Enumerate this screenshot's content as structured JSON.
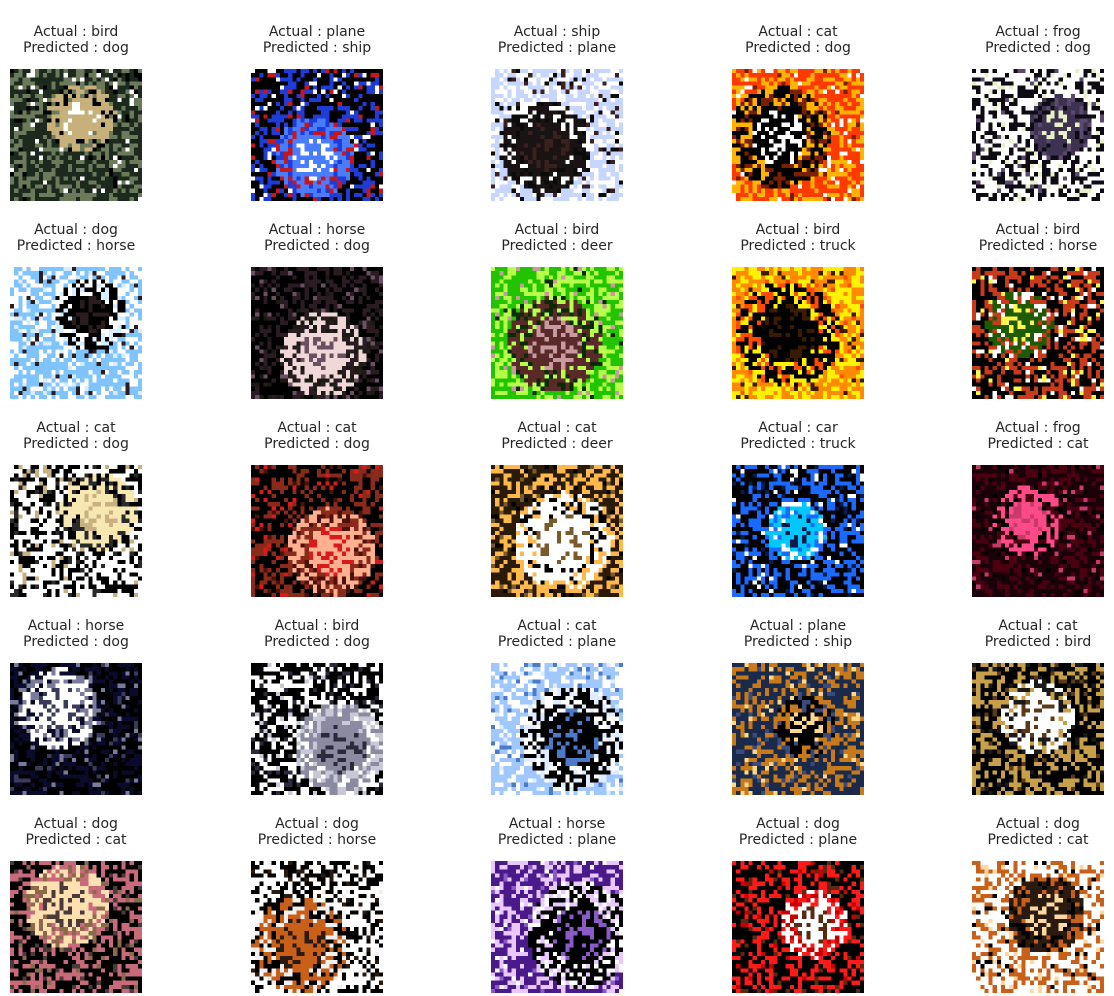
{
  "grid": {
    "rows": 5,
    "cols": 5,
    "panels": [
      {
        "actual": "Actual : bird",
        "predicted": "Predicted : dog",
        "image": "bird-perched-branch",
        "colors": [
          "#1b2a1d",
          "#6a7a5a",
          "#c8b07a",
          "#ffffff",
          "#000000"
        ]
      },
      {
        "actual": "Actual : plane",
        "predicted": "Predicted : ship",
        "image": "plane-in-blue-circle",
        "colors": [
          "#000000",
          "#1e3cd8",
          "#4a7cff",
          "#ffffff",
          "#c9161b"
        ]
      },
      {
        "actual": "Actual : ship",
        "predicted": "Predicted : plane",
        "image": "ship-dark-hull",
        "colors": [
          "#c7d6ff",
          "#ffffff",
          "#1a1313",
          "#3b2020",
          "#0b0b0b"
        ]
      },
      {
        "actual": "Actual : cat",
        "predicted": "Predicted : dog",
        "image": "cat-on-orange",
        "colors": [
          "#ff3a00",
          "#ffb400",
          "#000000",
          "#ffffff",
          "#7a1f00"
        ]
      },
      {
        "actual": "Actual : frog",
        "predicted": "Predicted : dog",
        "image": "frog-dark-blob",
        "colors": [
          "#ffffff",
          "#0e0b14",
          "#3d3350",
          "#e8f0c8",
          "#5a4a6e"
        ]
      },
      {
        "actual": "Actual : dog",
        "predicted": "Predicted : horse",
        "image": "dog-on-beach",
        "colors": [
          "#7fc3ff",
          "#ffffff",
          "#000000",
          "#2b1d1d",
          "#d8ecff"
        ]
      },
      {
        "actual": "Actual : horse",
        "predicted": "Predicted : dog",
        "image": "horse-dark-scene",
        "colors": [
          "#000000",
          "#2a1c22",
          "#f0d8d8",
          "#6a5060",
          "#1a1a12"
        ]
      },
      {
        "actual": "Actual : bird",
        "predicted": "Predicted : deer",
        "image": "bird-green-grass",
        "colors": [
          "#22c400",
          "#b6ff4a",
          "#5a2a2a",
          "#c89aa0",
          "#0a2a00"
        ]
      },
      {
        "actual": "Actual : bird",
        "predicted": "Predicted : truck",
        "image": "bird-yellow-stripes",
        "colors": [
          "#ff8a00",
          "#fff200",
          "#000000",
          "#3a1a00",
          "#ff4a00"
        ]
      },
      {
        "actual": "Actual : bird",
        "predicted": "Predicted : horse",
        "image": "bird-red-on-branch",
        "colors": [
          "#000000",
          "#c83a1a",
          "#1e5a00",
          "#fff84a",
          "#ffffff"
        ]
      },
      {
        "actual": "Actual : cat",
        "predicted": "Predicted : dog",
        "image": "cat-black-on-white",
        "colors": [
          "#ffffff",
          "#000000",
          "#f6e8b0",
          "#c8b080",
          "#2a2a2a"
        ]
      },
      {
        "actual": "Actual : cat",
        "predicted": "Predicted : dog",
        "image": "cat-dark-red",
        "colors": [
          "#000000",
          "#8a2a1a",
          "#ffb090",
          "#d81a1a",
          "#4a1208"
        ]
      },
      {
        "actual": "Actual : cat",
        "predicted": "Predicted : deer",
        "image": "cat-tabby-face",
        "colors": [
          "#2a1a08",
          "#ffb84a",
          "#ffffff",
          "#7a5a2a",
          "#000000"
        ]
      },
      {
        "actual": "Actual : car",
        "predicted": "Predicted : truck",
        "image": "car-blue-dark",
        "colors": [
          "#000000",
          "#1a6aff",
          "#00c8ff",
          "#0a1a4a",
          "#ffffff"
        ]
      },
      {
        "actual": "Actual : frog",
        "predicted": "Predicted : cat",
        "image": "frog-dark-magenta",
        "colors": [
          "#1a0008",
          "#4a0010",
          "#ff4a8a",
          "#c83a6a",
          "#000000"
        ]
      },
      {
        "actual": "Actual : horse",
        "predicted": "Predicted : dog",
        "image": "horse-dark-blue",
        "colors": [
          "#000000",
          "#0a0a2a",
          "#ffffff",
          "#3a3a5a",
          "#7a7a9a"
        ]
      },
      {
        "actual": "Actual : bird",
        "predicted": "Predicted : dog",
        "image": "bird-white-dark",
        "colors": [
          "#000000",
          "#ffffff",
          "#8a8aa0",
          "#2a2a3a",
          "#c8c8d8"
        ]
      },
      {
        "actual": "Actual : cat",
        "predicted": "Predicted : plane",
        "image": "cat-white-blue",
        "colors": [
          "#a0c8ff",
          "#ffffff",
          "#000000",
          "#4a7ac8",
          "#e0ecff"
        ]
      },
      {
        "actual": "Actual : plane",
        "predicted": "Predicted : ship",
        "image": "plane-dark-orange",
        "colors": [
          "#1a2a4a",
          "#c87a1a",
          "#000000",
          "#ffd88a",
          "#3a4a7a"
        ]
      },
      {
        "actual": "Actual : cat",
        "predicted": "Predicted : bird",
        "image": "cat-dark-gold",
        "colors": [
          "#000000",
          "#c8a04a",
          "#ffffff",
          "#5a3a1a",
          "#1a1a1a"
        ]
      },
      {
        "actual": "Actual : dog",
        "predicted": "Predicted : cat",
        "image": "dog-dark-closeup",
        "colors": [
          "#000000",
          "#c86a7a",
          "#ffe0b0",
          "#4a3a3a",
          "#8a6a4a"
        ]
      },
      {
        "actual": "Actual : dog",
        "predicted": "Predicted : horse",
        "image": "dog-doberman-white",
        "colors": [
          "#ffffff",
          "#000000",
          "#c8601a",
          "#2a1a10",
          "#f0f0f0"
        ]
      },
      {
        "actual": "Actual : horse",
        "predicted": "Predicted : plane",
        "image": "horse-purple-sky",
        "colors": [
          "#4a1a8a",
          "#e8c8ff",
          "#000000",
          "#8a5ac8",
          "#ffffff"
        ]
      },
      {
        "actual": "Actual : dog",
        "predicted": "Predicted : plane",
        "image": "dog-red-chair",
        "colors": [
          "#000000",
          "#ff1a1a",
          "#ffffff",
          "#5a2a10",
          "#c80000"
        ]
      },
      {
        "actual": "Actual : dog",
        "predicted": "Predicted : cat",
        "image": "dog-gold-on-white",
        "colors": [
          "#ffffff",
          "#c8601a",
          "#2a1a10",
          "#ffd8a0",
          "#000000"
        ]
      }
    ]
  }
}
